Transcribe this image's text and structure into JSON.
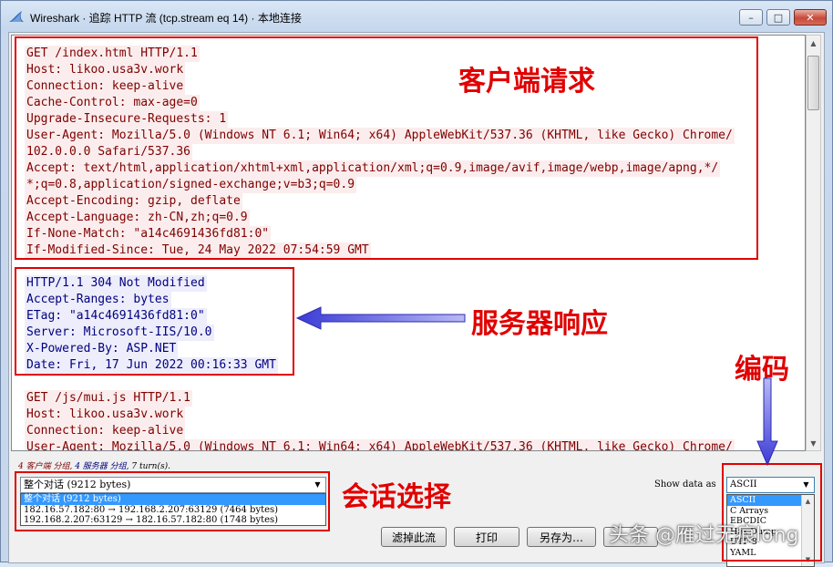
{
  "window": {
    "title": "Wireshark · 追踪 HTTP 流 (tcp.stream eq 14) · 本地连接",
    "controls": {
      "minimize": "–",
      "maximize": "□",
      "close": "✕"
    }
  },
  "stream": {
    "lines": [
      {
        "text": "GET /index.html HTTP/1.1",
        "dir": "cli"
      },
      {
        "text": "Host: likoo.usa3v.work",
        "dir": "cli"
      },
      {
        "text": "Connection: keep-alive",
        "dir": "cli"
      },
      {
        "text": "Cache-Control: max-age=0",
        "dir": "cli"
      },
      {
        "text": "Upgrade-Insecure-Requests: 1",
        "dir": "cli"
      },
      {
        "text": "User-Agent: Mozilla/5.0 (Windows NT 6.1; Win64; x64) AppleWebKit/537.36 (KHTML, like Gecko) Chrome/",
        "dir": "cli"
      },
      {
        "text": "102.0.0.0 Safari/537.36",
        "dir": "cli"
      },
      {
        "text": "Accept: text/html,application/xhtml+xml,application/xml;q=0.9,image/avif,image/webp,image/apng,*/",
        "dir": "cli"
      },
      {
        "text": "*;q=0.8,application/signed-exchange;v=b3;q=0.9",
        "dir": "cli"
      },
      {
        "text": "Accept-Encoding: gzip, deflate",
        "dir": "cli"
      },
      {
        "text": "Accept-Language: zh-CN,zh;q=0.9",
        "dir": "cli"
      },
      {
        "text": "If-None-Match: \"a14c4691436fd81:0\"",
        "dir": "cli"
      },
      {
        "text": "If-Modified-Since: Tue, 24 May 2022 07:54:59 GMT",
        "dir": "cli"
      },
      {
        "text": "",
        "dir": "gap"
      },
      {
        "text": "HTTP/1.1 304 Not Modified",
        "dir": "srv"
      },
      {
        "text": "Accept-Ranges: bytes",
        "dir": "srv"
      },
      {
        "text": "ETag: \"a14c4691436fd81:0\"",
        "dir": "srv"
      },
      {
        "text": "Server: Microsoft-IIS/10.0",
        "dir": "srv"
      },
      {
        "text": "X-Powered-By: ASP.NET",
        "dir": "srv"
      },
      {
        "text": "Date: Fri, 17 Jun 2022 00:16:33 GMT",
        "dir": "srv"
      },
      {
        "text": "",
        "dir": "gap"
      },
      {
        "text": "GET /js/mui.js HTTP/1.1",
        "dir": "cli"
      },
      {
        "text": "Host: likoo.usa3v.work",
        "dir": "cli"
      },
      {
        "text": "Connection: keep-alive",
        "dir": "cli"
      },
      {
        "text": "User-Agent: Mozilla/5.0 (Windows NT 6.1; Win64; x64) AppleWebKit/537.36 (KHTML, like Gecko) Chrome/",
        "dir": "cli"
      }
    ]
  },
  "summary": {
    "client_part": "4 客户端 分组,",
    "server_part": "4 服务器 分组,",
    "turns": "7 turn(s)."
  },
  "conversation": {
    "selected": "整个对话 (9212 bytes)",
    "options": [
      "整个对话 (9212 bytes)",
      "182.16.57.182:80 → 192.168.2.207:63129 (7464 bytes)",
      "192.168.2.207:63129 → 182.16.57.182:80 (1748 bytes)"
    ]
  },
  "show_data_as": {
    "label": "Show data as",
    "selected": "ASCII",
    "options": [
      "ASCII",
      "C Arrays",
      "EBCDIC",
      "Hex Dump",
      "UTF-8",
      "YAML"
    ]
  },
  "buttons": {
    "filter_out": "滤掉此流",
    "print": "打印",
    "save_as": "另存为…"
  },
  "annotations": {
    "client_request": "客户端请求",
    "server_response": "服务器响应",
    "encoding": "编码",
    "conversation_select": "会话选择",
    "accent": "#e00000",
    "arrow_color": "#6a6ae8"
  },
  "watermark": "头条 @雁过无痕long",
  "colors": {
    "client_bg": "#fbeded",
    "client_fg": "#7f0000",
    "server_bg": "#ededfb",
    "server_fg": "#00007f",
    "selection": "#3399ff"
  }
}
